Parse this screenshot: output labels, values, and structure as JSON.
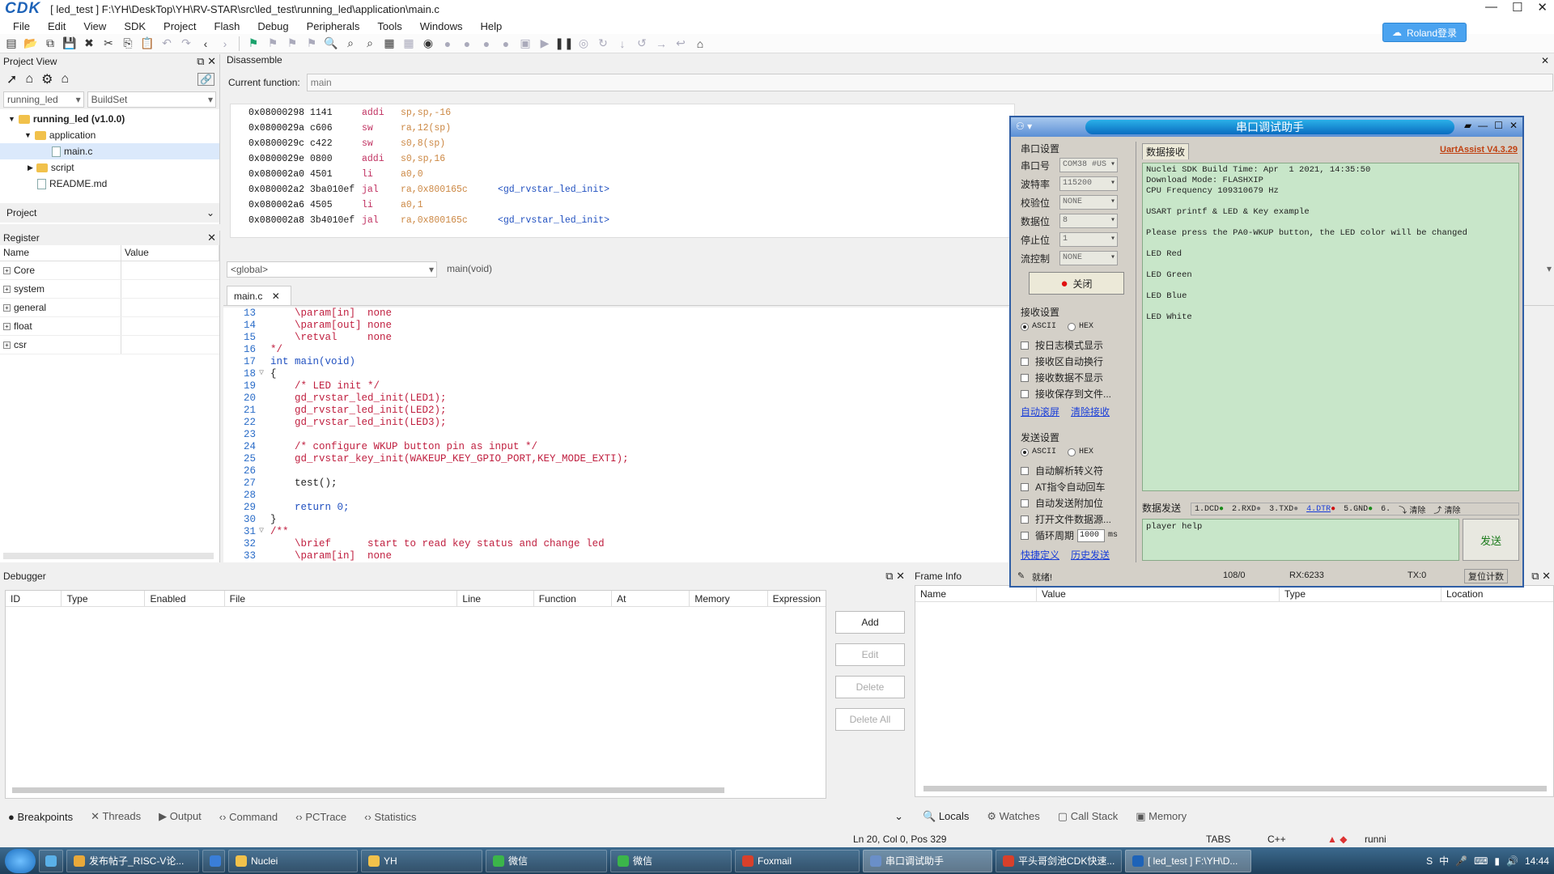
{
  "window": {
    "logo": "CDK",
    "title": "[ led_test ] F:\\YH\\DeskTop\\YH\\RV-STAR\\src\\led_test\\running_led\\application\\main.c",
    "login_label": "Roland登录"
  },
  "menu": [
    "File",
    "Edit",
    "View",
    "SDK",
    "Project",
    "Flash",
    "Debug",
    "Peripherals",
    "Tools",
    "Windows",
    "Help"
  ],
  "project_view": {
    "title": "Project View",
    "project_combo": "running_led",
    "buildset_combo": "BuildSet",
    "tree": {
      "root": "running_led (v1.0.0)",
      "application": "application",
      "main_c": "main.c",
      "script": "script",
      "readme": "README.md"
    },
    "project_label": "Project"
  },
  "register": {
    "title": "Register",
    "col_name": "Name",
    "col_value": "Value",
    "rows": [
      "Core",
      "system",
      "general",
      "float",
      "csr"
    ]
  },
  "disassemble": {
    "title": "Disassemble",
    "current_function_label": "Current function:",
    "current_function": "main",
    "lines": [
      {
        "addr": "0x08000298",
        "op": "1141",
        "mn": "addi",
        "args": "sp,sp,-16",
        "sym": ""
      },
      {
        "addr": "0x0800029a",
        "op": "c606",
        "mn": "sw",
        "args": "ra,12(sp)",
        "sym": ""
      },
      {
        "addr": "0x0800029c",
        "op": "c422",
        "mn": "sw",
        "args": "s0,8(sp)",
        "sym": ""
      },
      {
        "addr": "0x0800029e",
        "op": "0800",
        "mn": "addi",
        "args": "s0,sp,16",
        "sym": ""
      },
      {
        "addr": "0x080002a0",
        "op": "4501",
        "mn": "li",
        "args": "a0,0",
        "sym": ""
      },
      {
        "addr": "0x080002a2",
        "op": "3ba010ef",
        "mn": "jal",
        "args": "ra,0x800165c",
        "sym": "<gd_rvstar_led_init>"
      },
      {
        "addr": "0x080002a6",
        "op": "4505",
        "mn": "li",
        "args": "a0,1",
        "sym": ""
      },
      {
        "addr": "0x080002a8",
        "op": "3b4010ef",
        "mn": "jal",
        "args": "ra,0x800165c",
        "sym": "<gd_rvstar_led_init>"
      }
    ]
  },
  "scope": {
    "global": "<global>",
    "function": "main(void)"
  },
  "editor": {
    "tab": "main.c",
    "lines": [
      {
        "n": "13",
        "text": "    \\param[in]  none",
        "cls": "cm"
      },
      {
        "n": "14",
        "text": "    \\param[out] none",
        "cls": "cm"
      },
      {
        "n": "15",
        "text": "    \\retval     none",
        "cls": "cm"
      },
      {
        "n": "16",
        "text": "*/",
        "cls": "cm"
      },
      {
        "n": "17",
        "text": "int main(void)",
        "cls": "kw"
      },
      {
        "n": "18",
        "text": "{",
        "cls": ""
      },
      {
        "n": "19",
        "text": "    /* LED init */",
        "cls": "cm"
      },
      {
        "n": "20",
        "text": "    gd_rvstar_led_init(LED1);",
        "cls": "fn"
      },
      {
        "n": "21",
        "text": "    gd_rvstar_led_init(LED2);",
        "cls": "fn"
      },
      {
        "n": "22",
        "text": "    gd_rvstar_led_init(LED3);",
        "cls": "fn"
      },
      {
        "n": "23",
        "text": "",
        "cls": ""
      },
      {
        "n": "24",
        "text": "    /* configure WKUP button pin as input */",
        "cls": "cm"
      },
      {
        "n": "25",
        "text": "    gd_rvstar_key_init(WAKEUP_KEY_GPIO_PORT,KEY_MODE_EXTI);",
        "cls": "fn"
      },
      {
        "n": "26",
        "text": "",
        "cls": ""
      },
      {
        "n": "27",
        "text": "    test();",
        "cls": ""
      },
      {
        "n": "28",
        "text": "",
        "cls": ""
      },
      {
        "n": "29",
        "text": "    return 0;",
        "cls": "kw"
      },
      {
        "n": "30",
        "text": "}",
        "cls": ""
      },
      {
        "n": "31",
        "text": "/**",
        "cls": "cm"
      },
      {
        "n": "32",
        "text": "    \\brief      start to read key status and change led",
        "cls": "cm"
      },
      {
        "n": "33",
        "text": "    \\param[in]  none",
        "cls": "cm"
      }
    ]
  },
  "debugger": {
    "title": "Debugger",
    "columns": [
      "ID",
      "Type",
      "Enabled",
      "File",
      "Line",
      "Function",
      "At",
      "Memory",
      "Expression"
    ],
    "buttons": {
      "add": "Add",
      "edit": "Edit",
      "delete": "Delete",
      "delete_all": "Delete All"
    },
    "tabs": [
      "Breakpoints",
      "Threads",
      "Output",
      "Command",
      "PCTrace",
      "Statistics"
    ]
  },
  "frame_info": {
    "title": "Frame Info",
    "columns": [
      "Name",
      "Value",
      "Type",
      "Location"
    ],
    "tabs": [
      "Locals",
      "Watches",
      "Call Stack",
      "Memory"
    ]
  },
  "statusbar": {
    "pos": "Ln 20, Col 0, Pos 329",
    "tabs": "TABS",
    "lang": "C++",
    "run": "runni"
  },
  "serial": {
    "title": "串口调试助手",
    "version": "UartAssist V4.3.29",
    "port_group": "串口设置",
    "port_label": "串口号",
    "port_value": "COM38 #US",
    "baud_label": "波特率",
    "baud_value": "115200",
    "parity_label": "校验位",
    "parity_value": "NONE",
    "data_label": "数据位",
    "data_value": "8",
    "stop_label": "停止位",
    "stop_value": "1",
    "flow_label": "流控制",
    "flow_value": "NONE",
    "close_btn": "关闭",
    "recv_group": "接收设置",
    "ascii": "ASCII",
    "hex": "HEX",
    "recv_opts": [
      "按日志模式显示",
      "接收区自动换行",
      "接收数据不显示",
      "接收保存到文件..."
    ],
    "auto_clear": "自动滚屏",
    "clear_recv": "清除接收",
    "send_group": "发送设置",
    "send_opts": [
      "自动解析转义符",
      "AT指令自动回车",
      "自动发送附加位",
      "打开文件数据源..."
    ],
    "loop_label": "循环周期",
    "loop_value": "1000",
    "loop_unit": "ms",
    "shortcut": "快捷定义",
    "history": "历史发送",
    "recv_tab": "数据接收",
    "recv_lines": [
      "Nuclei SDK Build Time: Apr  1 2021, 14:35:50",
      "Download Mode: FLASHXIP",
      "CPU Frequency 109310679 Hz",
      "",
      "USART printf & LED & Key example",
      "",
      "Please press the PA0-WKUP button, the LED color will be changed",
      "",
      "LED Red",
      "",
      "LED Green",
      "",
      "LED Blue",
      "",
      "LED White"
    ],
    "send_tab": "数据发送",
    "pins": [
      "1.DCD",
      "2.RXD",
      "3.TXD",
      "4.DTR",
      "5.GND",
      "6."
    ],
    "clear1": "清除",
    "clear2": "清除",
    "send_text": "player help",
    "send_btn": "发送",
    "status_ready": "就绪!",
    "status_count": "108/0",
    "status_rx": "RX:6233",
    "status_tx": "TX:0",
    "status_reset": "复位计数"
  },
  "taskbar": {
    "items": [
      "发布帖子_RISC-V论...",
      "Nuclei",
      "YH",
      "微信",
      "微信",
      "Foxmail",
      "串口调试助手",
      "平头哥剑池CDK快速...",
      "[ led_test ] F:\\YH\\D..."
    ],
    "clock": "14:44"
  }
}
